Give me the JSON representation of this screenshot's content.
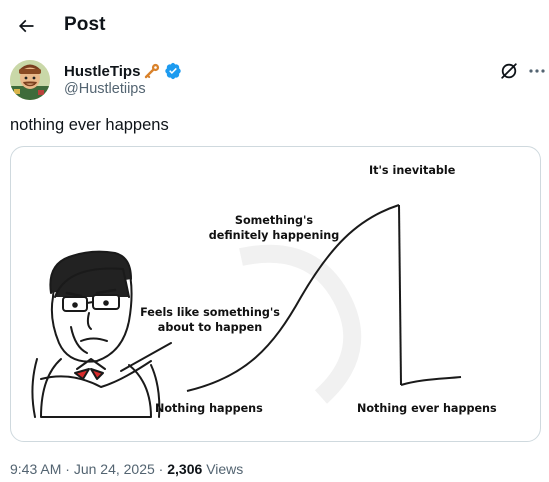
{
  "header": {
    "title": "Post"
  },
  "author": {
    "display_name": "HustleTips",
    "handle": "@Hustletiips",
    "verified": true,
    "accent": "#1d9bf0"
  },
  "tweet": {
    "text": "nothing ever happens"
  },
  "meme": {
    "labels": {
      "top": "It's inevitable",
      "upper": "Something's definitely happening",
      "middle": "Feels like something's about to happen",
      "bottom_left": "Nothing happens",
      "bottom_right": "Nothing ever happens"
    }
  },
  "meta": {
    "time": "9:43 AM",
    "date": "Jun 24, 2025",
    "views_count": "2,306",
    "views_label": "Views"
  },
  "icons": [
    "back-arrow-icon",
    "key-icon",
    "verified-badge-icon",
    "grok-icon",
    "more-icon"
  ]
}
